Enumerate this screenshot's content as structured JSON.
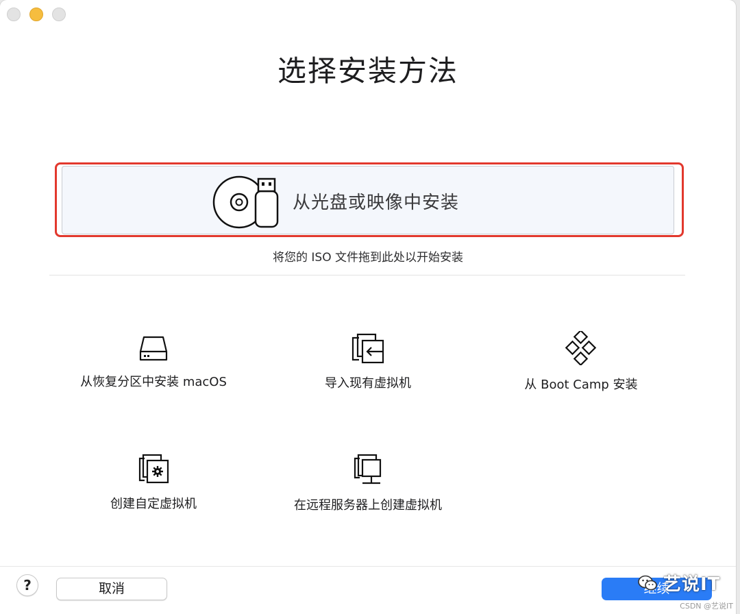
{
  "window": {
    "title": "选择安装方法"
  },
  "iso_option": {
    "label": "从光盘或映像中安装",
    "hint": "将您的 ISO 文件拖到此处以开始安装",
    "icon": "disc-usb-icon"
  },
  "options": [
    {
      "label": "从恢复分区中安装 macOS",
      "icon": "hard-drive-icon"
    },
    {
      "label": "导入现有虚拟机",
      "icon": "import-vm-icon"
    },
    {
      "label": "从 Boot Camp 安装",
      "icon": "bootcamp-icon"
    },
    {
      "label": "创建自定虚拟机",
      "icon": "custom-vm-icon"
    },
    {
      "label": "在远程服务器上创建虚拟机",
      "icon": "remote-server-icon"
    }
  ],
  "footer": {
    "help_label": "?",
    "cancel_label": "取消",
    "continue_label": "继续"
  },
  "watermark": {
    "text": "艺说IT",
    "csdn": "CSDN @艺说IT"
  },
  "colors": {
    "highlight_outline": "#e2382d",
    "primary_button": "#2a7cf6",
    "card_background": "#f4f7fc"
  }
}
